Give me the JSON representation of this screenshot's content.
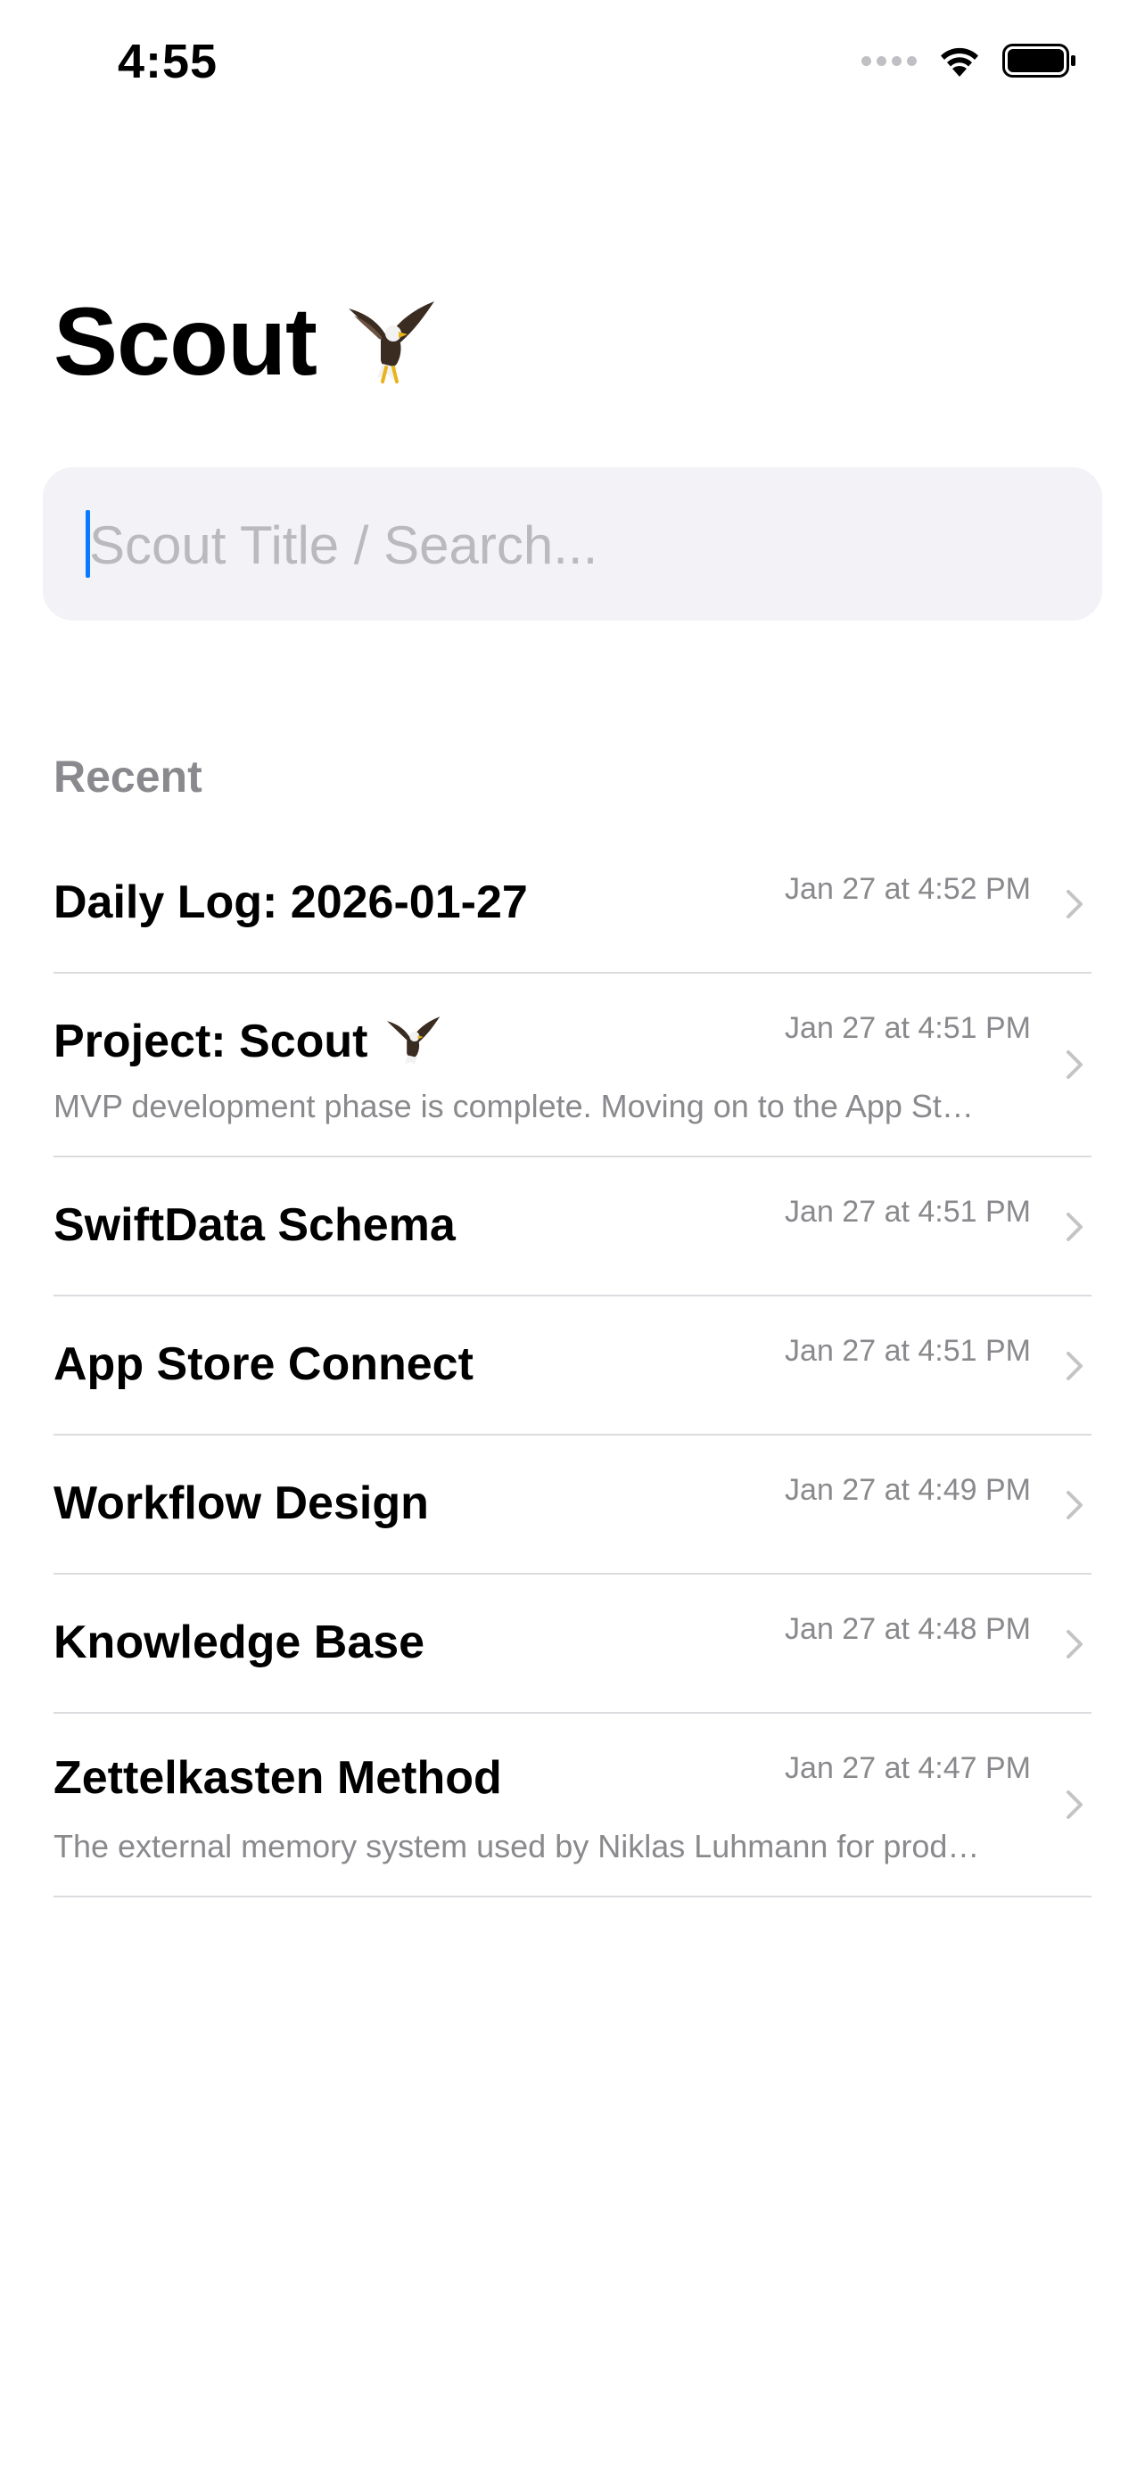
{
  "status_bar": {
    "time": "4:55",
    "signal_icon": "signal-dots-icon",
    "wifi_icon": "wifi-icon",
    "battery_icon": "battery-icon"
  },
  "header": {
    "title": "Scout",
    "emoji_icon": "eagle-icon"
  },
  "search": {
    "placeholder": "Scout Title / Search...",
    "value": ""
  },
  "recent": {
    "section_label": "Recent",
    "items": [
      {
        "title": "Daily Log: 2026-01-27",
        "date": "Jan 27 at 4:52 PM",
        "preview": ""
      },
      {
        "title": "Project: Scout",
        "date": "Jan 27 at 4:51 PM",
        "preview": "MVP development phase is complete. Moving on to the App St…"
      },
      {
        "title": "SwiftData Schema",
        "date": "Jan 27 at 4:51 PM",
        "preview": ""
      },
      {
        "title": "App Store Connect",
        "date": "Jan 27 at 4:51 PM",
        "preview": ""
      },
      {
        "title": "Workflow Design",
        "date": "Jan 27 at 4:49 PM",
        "preview": ""
      },
      {
        "title": "Knowledge Base",
        "date": "Jan 27 at 4:48 PM",
        "preview": ""
      },
      {
        "title": "Zettelkasten Method",
        "date": "Jan 27 at 4:47 PM",
        "preview": "The external memory system used by Niklas Luhmann for prod…"
      }
    ]
  },
  "colors": {
    "accent": "#0a7aff",
    "secondary_text": "#8a8a8e",
    "search_background": "#f2f2f7",
    "separator": "#dcdce0"
  }
}
